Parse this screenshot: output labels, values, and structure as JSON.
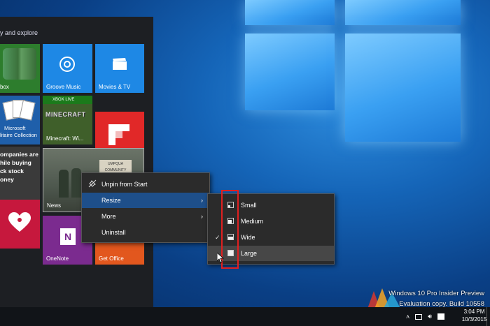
{
  "start_menu": {
    "header": "y and explore",
    "tiles": {
      "xbox": "box",
      "groove": "Groove Music",
      "movies": "Movies & TV",
      "solitaire_line1": "Microsoft",
      "solitaire_line2": "litaire Collection",
      "minecraft": "Minecraft: Wi...",
      "minecraft_badge": "XBOX LIVE",
      "minecraft_logo": "MINECRAFT",
      "news_headline_1": "ompanies are",
      "news_headline_2": "hile buying",
      "news_headline_3": "ck stock",
      "news_headline_4": "oney",
      "news": "News",
      "news_sign": "UMPQUA COMMUNITY COLLEGE",
      "onenote": "OneNote",
      "get_office": "Get Office"
    }
  },
  "context_menu": {
    "items": [
      {
        "label": "Unpin from Start"
      },
      {
        "label": "Resize"
      },
      {
        "label": "More"
      },
      {
        "label": "Uninstall"
      }
    ]
  },
  "resize_submenu": {
    "items": [
      {
        "label": "Small"
      },
      {
        "label": "Medium"
      },
      {
        "label": "Wide"
      },
      {
        "label": "Large"
      }
    ],
    "checked": "Wide",
    "hovered": "Large"
  },
  "watermark": {
    "line1": "Windows 10 Pro Insider Preview",
    "line2": "Evaluation copy. Build 10558"
  },
  "taskbar": {
    "time": "3:04 PM",
    "date": "10/3/2015"
  },
  "colors": {
    "accent_blue": "#1e88e5",
    "menu_bg": "#2b2b2b",
    "highlight_red": "#e02020"
  }
}
